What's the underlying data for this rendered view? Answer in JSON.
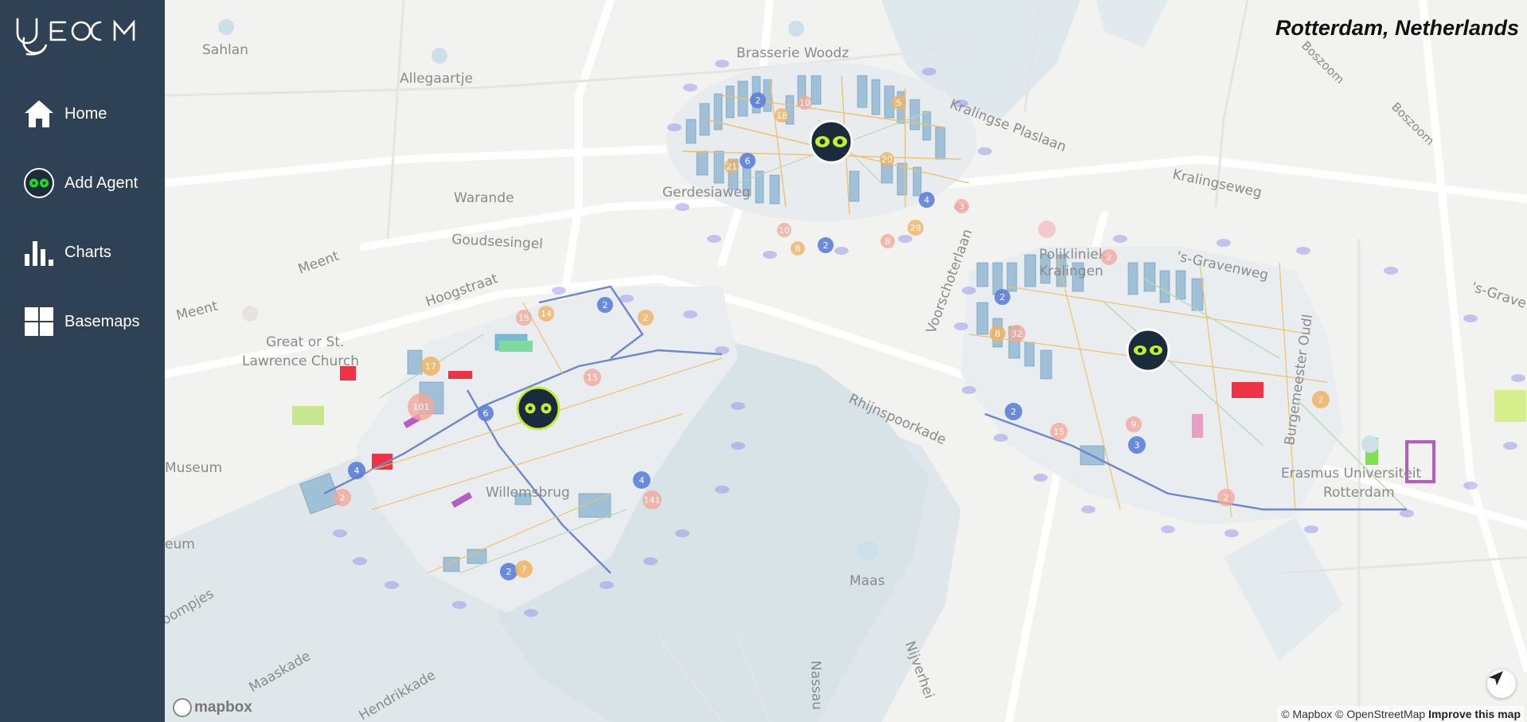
{
  "app": {
    "logo_text": "UGEOM"
  },
  "sidebar": {
    "items": [
      {
        "label": "Home",
        "icon": "home-icon"
      },
      {
        "label": "Add Agent",
        "icon": "agent-icon"
      },
      {
        "label": "Charts",
        "icon": "bar-chart-icon"
      },
      {
        "label": "Basemaps",
        "icon": "grid-icon"
      }
    ]
  },
  "map": {
    "title": "Rotterdam, Netherlands",
    "labels": {
      "sahlan": "Sahlan",
      "allegaartje": "Allegaartje",
      "brasserie": "Brasserie Woodz",
      "kralingse_plaslaan": "Kralingse Plaslaan",
      "kralingseweg": "Kralingseweg",
      "boszoom1": "Boszoom",
      "boszoom2": "Boszoom",
      "warande": "Warande",
      "goudsesingel": "Goudsesingel",
      "gerdesiaweg": "Gerdesiaweg",
      "meent1": "Meent",
      "meent2": "Meent",
      "hoogstraat": "Hoogstraat",
      "church": "Great or St.",
      "church2": "Lawrence Church",
      "museum1": "Museum",
      "museum2": "eum",
      "voorschoterlaan": "Voorschoterlaan",
      "polikliniek": "Polikliniek",
      "kralingen": "Kralingen",
      "gravenweg": "'s-Gravenweg",
      "gravenweg2": "'s-Grave",
      "burgemeester": "Burgemeester Oudl",
      "rhijnspoorkade": "Rhijnspoorkade",
      "erasmus1": "Erasmus Universiteit",
      "erasmus2": "Rotterdam",
      "willemsbrug": "Willemsbrug",
      "maas": "Maas",
      "boompjes": "oompjes",
      "maaskade": "Maaskade",
      "hendrikkade": "Hendrikkade",
      "nassau": "Nassau",
      "nijverheid": "Nijverhei"
    },
    "clusters": {
      "a1": "2",
      "a2": "10",
      "a3": "18",
      "a4": "6",
      "a5": "21",
      "a6": "20",
      "a7": "4",
      "a8": "3",
      "a9": "10",
      "a10": "8",
      "a11": "2",
      "a12": "29",
      "a13": "8",
      "a14": "5",
      "b1": "15",
      "b2": "14",
      "b3": "2",
      "b4": "2",
      "b5": "17",
      "b6": "101",
      "b7": "6",
      "b8": "15",
      "b9": "4",
      "b10": "2",
      "b11": "4",
      "b12": "141",
      "b13": "2",
      "b14": "7",
      "c1": "2",
      "c2": "8",
      "c3": "32",
      "c4": "2",
      "c5": "15",
      "c6": "9",
      "c7": "3",
      "c8": "2",
      "c9": "2",
      "c10": "2"
    },
    "attribution": "© Mapbox © OpenStreetMap",
    "improve": "Improve this map",
    "mapbox_logo": "mapbox"
  },
  "colors": {
    "sidebar_bg": "#2f4154",
    "agent_green": "#c4ef2e",
    "agent_dark": "#1a2b3d",
    "cluster_blue": "#5b7fdc",
    "cluster_pink": "#f4a89a",
    "cluster_orange": "#f0b261",
    "water": "#dde6ea"
  }
}
